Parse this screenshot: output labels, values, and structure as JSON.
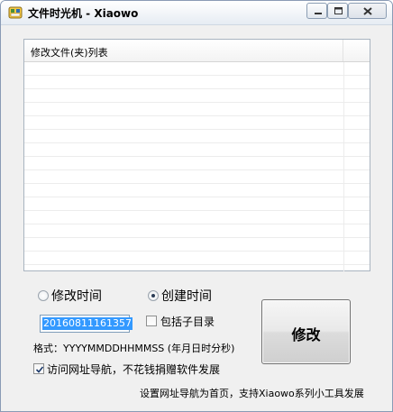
{
  "window": {
    "title": "文件时光机 - Xiaowo",
    "icon": "app-icon"
  },
  "list": {
    "column_header": "修改文件(夹)列表"
  },
  "time_mode": {
    "options": [
      {
        "label": "修改时间",
        "selected": false
      },
      {
        "label": "创建时间",
        "selected": true
      }
    ]
  },
  "date_input": {
    "value": "20160811161357"
  },
  "include_subdirs": {
    "label": "包括子目录",
    "checked": false
  },
  "format_hint": "格式：YYYYMMDDHHMMSS (年月日时分秒)",
  "nav_checkbox": {
    "label": "访问网址导航，不花钱捐赠软件发展",
    "checked": true
  },
  "modify_button": {
    "label": "修改"
  },
  "footer_text": "设置网址导航为首页，支持Xiaowo系列小工具发展",
  "colors": {
    "selection": "#3399ff",
    "window_bg": "#f0f0f0"
  }
}
